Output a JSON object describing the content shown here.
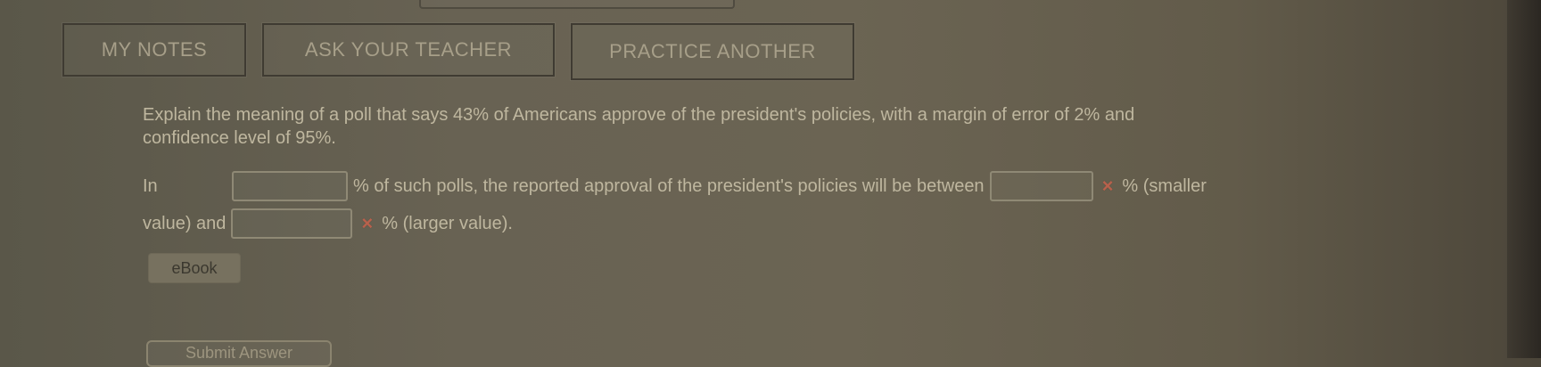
{
  "toolbar": {
    "my_notes": "MY NOTES",
    "ask_teacher": "ASK YOUR TEACHER",
    "practice_another": "PRACTICE ANOTHER"
  },
  "question": {
    "prompt_line1": "Explain the meaning of a poll that says 43% of Americans approve of the president's policies, with a margin of error of 2% and",
    "prompt_line2": "confidence level of 95%."
  },
  "answer": {
    "in": "In",
    "middle_text": "% of such polls, the reported approval of the president's policies will be between",
    "smaller_value_suffix": "% (smaller",
    "value_and": "value) and",
    "larger_value_suffix": "% (larger value)."
  },
  "buttons": {
    "ebook": "eBook",
    "submit": "Submit Answer"
  },
  "icons": {
    "wrong_answer": "×"
  }
}
